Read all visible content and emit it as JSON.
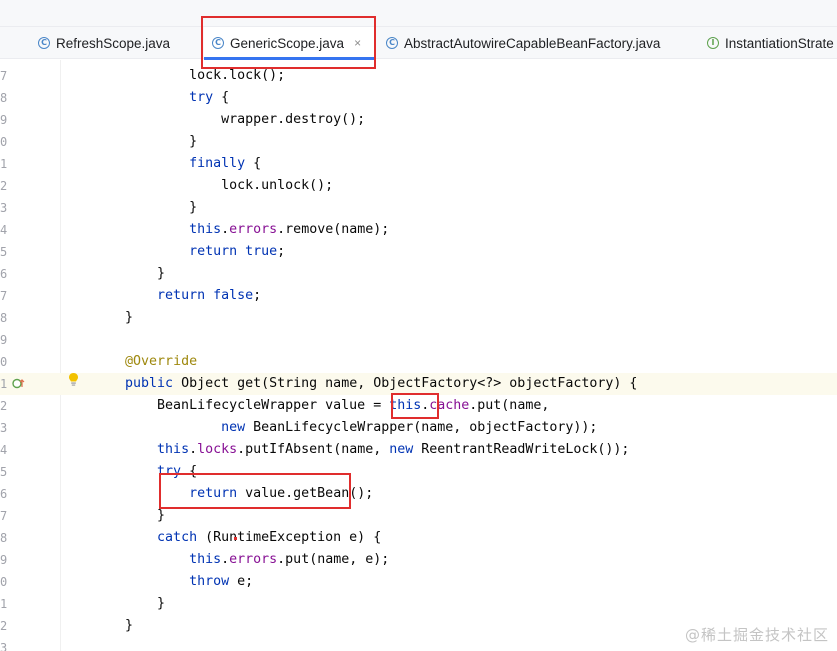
{
  "tabs": [
    {
      "label": "RefreshScope.java",
      "icon": "class-icon",
      "active": false
    },
    {
      "label": "GenericScope.java",
      "icon": "class-icon",
      "active": true,
      "close": "×"
    },
    {
      "label": "AbstractAutowireCapableBeanFactory.java",
      "icon": "class-icon",
      "active": false
    },
    {
      "label": "InstantiationStrate",
      "icon": "interface-icon",
      "active": false
    }
  ],
  "tab_icon_letters": {
    "class": "C",
    "interface": "I"
  },
  "line_numbers": [
    "7",
    "8",
    "9",
    "0",
    "1",
    "2",
    "3",
    "4",
    "5",
    "6",
    "7",
    "8",
    "9",
    "0",
    "1",
    "2",
    "3",
    "4",
    "5",
    "6",
    "7",
    "8",
    "9",
    "0",
    "1",
    "2",
    "3"
  ],
  "code_lines": [
    "            lock.lock();",
    "            try {",
    "                wrapper.destroy();",
    "            }",
    "            finally {",
    "                lock.unlock();",
    "            }",
    "            this.errors.remove(name);",
    "            return true;",
    "        }",
    "        return false;",
    "    }",
    "",
    "    @Override",
    "    public Object get(String name, ObjectFactory<?> objectFactory) {",
    "        BeanLifecycleWrapper value = this.cache.put(name,",
    "                new BeanLifecycleWrapper(name, objectFactory));",
    "        this.locks.putIfAbsent(name, new ReentrantReadWriteLock());",
    "        try {",
    "            return value.getBean();",
    "        }",
    "        catch (RuntimeException e) {",
    "            this.errors.put(name, e);",
    "            throw e;",
    "        }",
    "    }",
    ""
  ],
  "watermark": "@稀土掘金技术社区",
  "colors": {
    "keyword": "#0033b3",
    "field": "#871094",
    "annotation": "#9e880d",
    "highlight_box": "#e02d2d",
    "active_tab_underline": "#3574f0"
  }
}
